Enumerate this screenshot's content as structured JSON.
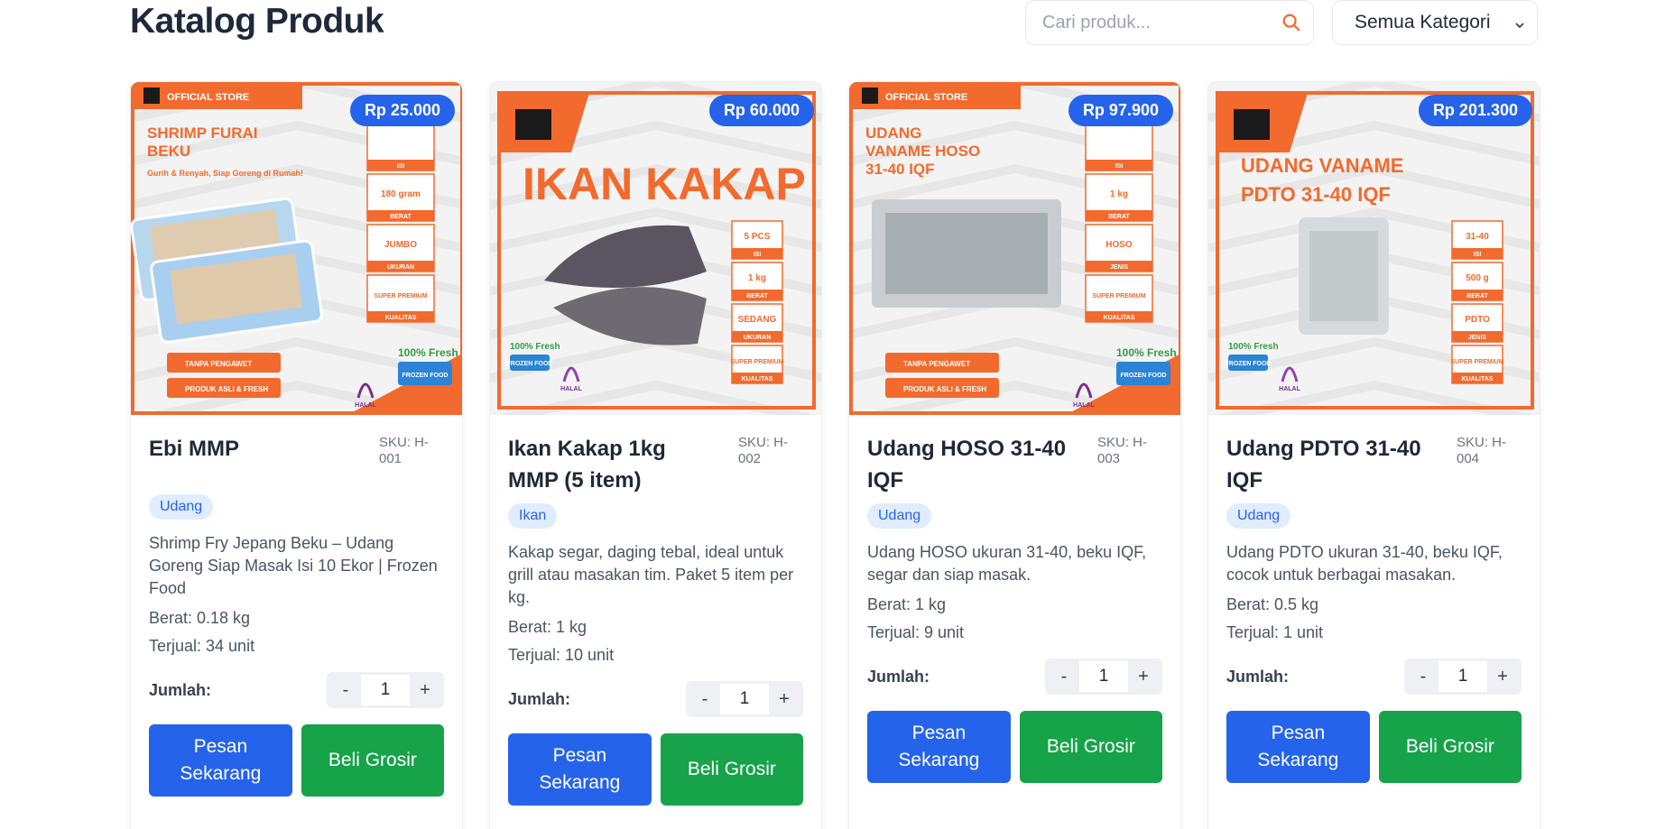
{
  "page": {
    "title": "Katalog Produk"
  },
  "search": {
    "placeholder": "Cari produk..."
  },
  "filter": {
    "selected": "Semua Kategori"
  },
  "labels": {
    "quantity": "Jumlah:",
    "order": "Pesan Sekarang",
    "bulk": "Beli Grosir"
  },
  "colors": {
    "primary": "#2563eb",
    "success": "#16a34a",
    "brand_orange": "#f26a2e"
  },
  "products": [
    {
      "name": "Ebi MMP",
      "sku": "SKU: H-001",
      "price": "Rp 25.000",
      "category": "Udang",
      "description": "Shrimp Fry Jepang Beku – Udang Goreng Siap Masak Isi 10 Ekor | Frozen Food",
      "weight": "Berat: 0.18 kg",
      "sold": "Terjual: 34 unit",
      "qty": "1",
      "image": {
        "banner": "OFFICIAL STORE",
        "headline": "SHRIMP FURAI BEKU",
        "tagline": "Gurih & Renyah, Siap Goreng di Rumah!",
        "specs": [
          {
            "value": "",
            "label": "ISI"
          },
          {
            "value": "180 gram",
            "label": "BERAT"
          },
          {
            "value": "JUMBO",
            "label": "UKURAN"
          },
          {
            "value": "SUPER PREMIUM",
            "label": "KUALITAS"
          }
        ],
        "badges": [
          "TANPA PENGAWET",
          "PRODUK ASLI & FRESH"
        ],
        "fresh": "100% Fresh",
        "frozen": "FROZEN FOOD",
        "halal": "HALAL"
      }
    },
    {
      "name": "Ikan Kakap 1kg MMP (5 item)",
      "sku": "SKU: H-002",
      "price": "Rp 60.000",
      "category": "Ikan",
      "description": "Kakap segar, daging tebal, ideal untuk grill atau masakan tim. Paket 5 item per kg.",
      "weight": "Berat: 1 kg",
      "sold": "Terjual: 10 unit",
      "qty": "1",
      "image": {
        "banner": "",
        "headline": "IKAN KAKAP",
        "tagline": "",
        "specs": [
          {
            "value": "5 PCS",
            "label": "ISI"
          },
          {
            "value": "1 kg",
            "label": "BERAT"
          },
          {
            "value": "SEDANG",
            "label": "UKURAN"
          },
          {
            "value": "SUPER PREMIUM",
            "label": "KUALITAS"
          }
        ],
        "badges": [],
        "fresh": "100% Fresh",
        "frozen": "FROZEN FOOD",
        "halal": "HALAL"
      }
    },
    {
      "name": "Udang HOSO 31-40 IQF",
      "sku": "SKU: H-003",
      "price": "Rp 97.900",
      "category": "Udang",
      "description": "Udang HOSO ukuran 31-40, beku IQF, segar dan siap masak.",
      "weight": "Berat: 1 kg",
      "sold": "Terjual: 9 unit",
      "qty": "1",
      "image": {
        "banner": "OFFICIAL STORE",
        "headline": "UDANG VANAME HOSO 31-40 IQF",
        "tagline": "",
        "specs": [
          {
            "value": "",
            "label": "ISI"
          },
          {
            "value": "1 kg",
            "label": "BERAT"
          },
          {
            "value": "HOSO",
            "label": "JENIS"
          },
          {
            "value": "SUPER PREMIUM",
            "label": "KUALITAS"
          }
        ],
        "badges": [
          "TANPA PENGAWET",
          "PRODUK ASLI & FRESH"
        ],
        "fresh": "100% Fresh",
        "frozen": "FROZEN FOOD",
        "halal": "HALAL"
      }
    },
    {
      "name": "Udang PDTO 31-40 IQF",
      "sku": "SKU: H-004",
      "price": "Rp 201.300",
      "category": "Udang",
      "description": "Udang PDTO ukuran 31-40, beku IQF, cocok untuk berbagai masakan.",
      "weight": "Berat: 0.5 kg",
      "sold": "Terjual: 1 unit",
      "qty": "1",
      "image": {
        "banner": "",
        "headline": "UDANG VANAME PDTO 31-40 IQF",
        "tagline": "",
        "specs": [
          {
            "value": "31-40",
            "label": "ISI"
          },
          {
            "value": "500 g",
            "label": "BERAT"
          },
          {
            "value": "PDTO",
            "label": "JENIS"
          },
          {
            "value": "SUPER PREMIUM",
            "label": "KUALITAS"
          }
        ],
        "badges": [],
        "fresh": "100% Fresh",
        "frozen": "FROZEN FOOD",
        "halal": "HALAL"
      }
    }
  ]
}
